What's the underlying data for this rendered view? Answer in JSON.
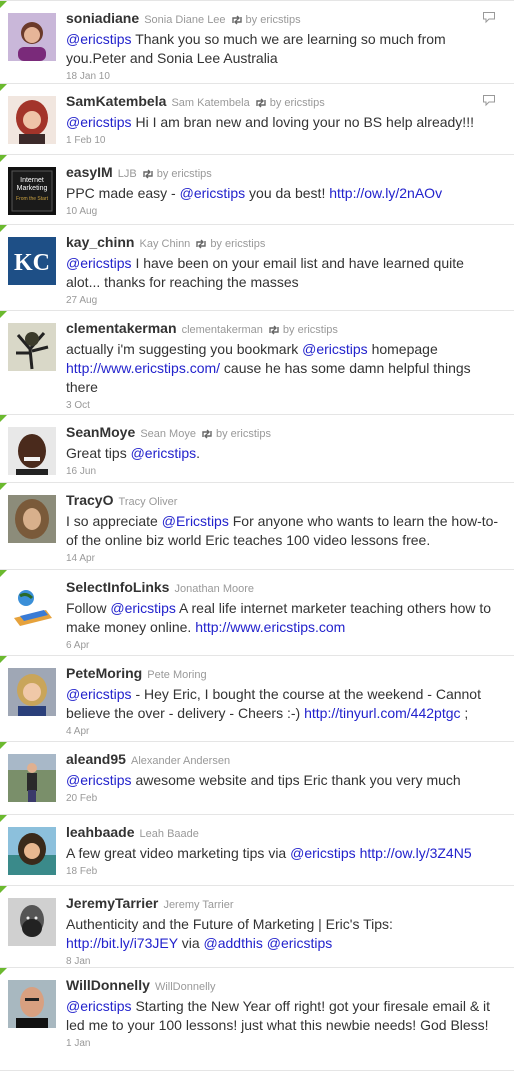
{
  "retweet_label": "by ericstips",
  "tweets": [
    {
      "screen_name": "soniadiane",
      "full_name": "Sonia Diane Lee",
      "retweeted": true,
      "reply_icon": true,
      "segments": [
        {
          "t": "@ericstips",
          "link": true
        },
        {
          "t": " Thank you so much we are learning so much from you.Peter and Sonia Lee Australia",
          "link": false
        }
      ],
      "date": "18 Jan 10",
      "avatar_icon": "avatar-woman-purple"
    },
    {
      "screen_name": "SamKatembela",
      "full_name": "Sam Katembela",
      "retweeted": true,
      "reply_icon": true,
      "segments": [
        {
          "t": "@ericstips",
          "link": true
        },
        {
          "t": " Hi I am bran new and loving your no BS help already!!!",
          "link": false
        }
      ],
      "date": "1 Feb 10",
      "avatar_icon": "avatar-woman-red-hair"
    },
    {
      "screen_name": "easyIM",
      "full_name": "LJB",
      "retweeted": true,
      "reply_icon": false,
      "segments": [
        {
          "t": "PPC made easy - ",
          "link": false
        },
        {
          "t": "@ericstips",
          "link": true
        },
        {
          "t": " you da best! ",
          "link": false
        },
        {
          "t": "http://ow.ly/2nAOv",
          "link": true
        }
      ],
      "date": "10 Aug",
      "avatar_icon": "avatar-internet-marketing-book",
      "avatar_text": [
        "Internet",
        "Marketing",
        "From the Start"
      ]
    },
    {
      "screen_name": "kay_chinn",
      "full_name": "Kay Chinn",
      "retweeted": true,
      "reply_icon": false,
      "segments": [
        {
          "t": "@ericstips",
          "link": true
        },
        {
          "t": " I have been on your email list and have learned quite alot... thanks for reaching the masses",
          "link": false
        }
      ],
      "date": "27 Aug",
      "avatar_icon": "avatar-kc-logo",
      "avatar_text": [
        "KC"
      ]
    },
    {
      "screen_name": "clementakerman",
      "full_name": "clementakerman",
      "retweeted": true,
      "reply_icon": false,
      "segments": [
        {
          "t": "actually i'm suggesting you bookmark ",
          "link": false
        },
        {
          "t": "@ericstips",
          "link": true
        },
        {
          "t": " homepage ",
          "link": false
        },
        {
          "t": "http://www.ericstips.com/",
          "link": true
        },
        {
          "t": " cause he has some damn helpful things there",
          "link": false
        }
      ],
      "date": "3 Oct",
      "avatar_icon": "avatar-dark-tree"
    },
    {
      "screen_name": "SeanMoye",
      "full_name": "Sean Moye",
      "retweeted": true,
      "reply_icon": false,
      "segments": [
        {
          "t": "Great tips ",
          "link": false
        },
        {
          "t": "@ericstips",
          "link": true
        },
        {
          "t": ".",
          "link": false
        }
      ],
      "date": "16 Jun",
      "avatar_icon": "avatar-man-smiling"
    },
    {
      "screen_name": "TracyO",
      "full_name": "Tracy Oliver",
      "retweeted": false,
      "reply_icon": false,
      "segments": [
        {
          "t": "I so appreciate ",
          "link": false
        },
        {
          "t": "@Ericstips",
          "link": true
        },
        {
          "t": " For anyone who wants to learn the how-to-of the online biz world Eric teaches 100 video lessons free.",
          "link": false
        }
      ],
      "date": "14 Apr",
      "avatar_icon": "avatar-woman-long-hair"
    },
    {
      "screen_name": "SelectInfoLinks",
      "full_name": "Jonathan Moore",
      "retweeted": false,
      "reply_icon": false,
      "segments": [
        {
          "t": "Follow ",
          "link": false
        },
        {
          "t": "@ericstips",
          "link": true
        },
        {
          "t": " A real life internet marketer teaching others how to make money online. ",
          "link": false
        },
        {
          "t": "http://www.ericstips.com",
          "link": true
        }
      ],
      "date": "6 Apr",
      "avatar_icon": "avatar-laptop-globe"
    },
    {
      "screen_name": "PeteMoring",
      "full_name": "Pete Moring",
      "retweeted": false,
      "reply_icon": false,
      "segments": [
        {
          "t": "@ericstips",
          "link": true
        },
        {
          "t": " - Hey Eric, I bought the course at the weekend - Cannot believe the over - delivery - Cheers :-) ",
          "link": false
        },
        {
          "t": "http://tinyurl.com/442ptgc",
          "link": true
        },
        {
          "t": " ;",
          "link": false
        }
      ],
      "date": "4 Apr",
      "avatar_icon": "avatar-woman-blonde"
    },
    {
      "screen_name": "aleand95",
      "full_name": "Alexander Andersen",
      "retweeted": false,
      "reply_icon": false,
      "segments": [
        {
          "t": "@ericstips",
          "link": true
        },
        {
          "t": " awesome website and tips Eric thank you very much",
          "link": false
        }
      ],
      "date": "20 Feb",
      "avatar_icon": "avatar-man-standing"
    },
    {
      "screen_name": "leahbaade",
      "full_name": "Leah Baade",
      "retweeted": false,
      "reply_icon": false,
      "segments": [
        {
          "t": "A few great video marketing tips via ",
          "link": false
        },
        {
          "t": "@ericstips",
          "link": true
        },
        {
          "t": " ",
          "link": false
        },
        {
          "t": "http://ow.ly/3Z4N5",
          "link": true
        }
      ],
      "date": "18 Feb",
      "avatar_icon": "avatar-woman-beach"
    },
    {
      "screen_name": "JeremyTarrier",
      "full_name": "Jeremy Tarrier",
      "retweeted": false,
      "reply_icon": false,
      "segments": [
        {
          "t": "Authenticity and the Future of Marketing | Eric's Tips: ",
          "link": false
        },
        {
          "t": "http://bit.ly/i73JEY",
          "link": true
        },
        {
          "t": " via ",
          "link": false
        },
        {
          "t": "@addthis",
          "link": true
        },
        {
          "t": " ",
          "link": false
        },
        {
          "t": "@ericstips",
          "link": true
        }
      ],
      "date": "8 Jan",
      "avatar_icon": "avatar-man-beard-bw"
    },
    {
      "screen_name": "WillDonnelly",
      "full_name": "WillDonnelly",
      "retweeted": false,
      "reply_icon": false,
      "segments": [
        {
          "t": "@ericstips",
          "link": true
        },
        {
          "t": " Starting the New Year off right! got your firesale email & it led me to your 100 lessons! just what this newbie needs! God Bless!",
          "link": false
        }
      ],
      "date": "1 Jan",
      "avatar_icon": "avatar-man-bald"
    }
  ]
}
